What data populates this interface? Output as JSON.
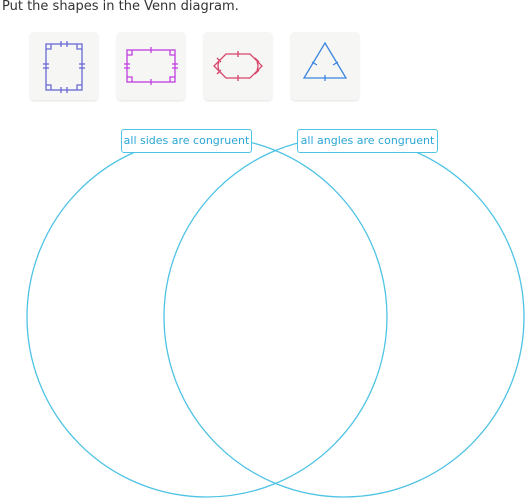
{
  "instruction": "Put the shapes in the Venn diagram.",
  "shapes": [
    {
      "icon": "rectangle-tall-icon",
      "color": "#6a6ad6"
    },
    {
      "icon": "rectangle-wide-icon",
      "color": "#c23ee0"
    },
    {
      "icon": "hexagon-icon",
      "color": "#d6456a"
    },
    {
      "icon": "equilateral-triangle-icon",
      "color": "#3a86e0"
    }
  ],
  "venn": {
    "left_label": "all sides are congruent",
    "right_label": "all angles are congruent",
    "circle_color": "#4fc3e4"
  }
}
